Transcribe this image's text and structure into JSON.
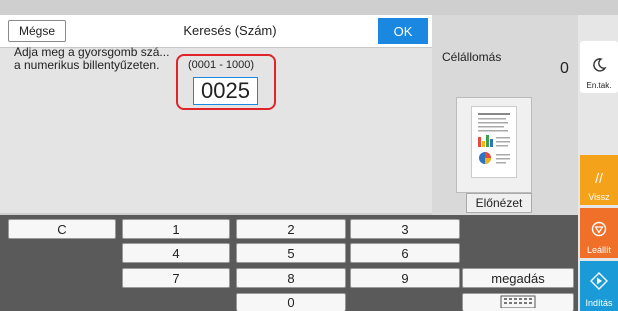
{
  "dialog": {
    "cancel_label": "Mégse",
    "title": "Keresés (Szám)",
    "ok_label": "OK",
    "instruction": "Adja meg a gyorsgomb szá...\na numerikus billentyűzeten.",
    "range": "(0001 - 1000)",
    "value": "0025"
  },
  "keypad": {
    "clear": "C",
    "keys": [
      "1",
      "2",
      "3",
      "4",
      "5",
      "6",
      "7",
      "8",
      "9",
      "0"
    ],
    "enter": "megadás"
  },
  "side": {
    "destination_label": "Célállomás",
    "destination_count": "0",
    "preview_label": "Előnézet"
  },
  "rail": {
    "energy_saver": "En.tak.",
    "back": "Vissz",
    "stop": "Leállít",
    "start": "Indítás"
  },
  "colors": {
    "accent": "#1a87e0",
    "highlight": "#e1232a",
    "back": "#f5a21b",
    "stop": "#f0702a",
    "start": "#1a9bd7"
  }
}
